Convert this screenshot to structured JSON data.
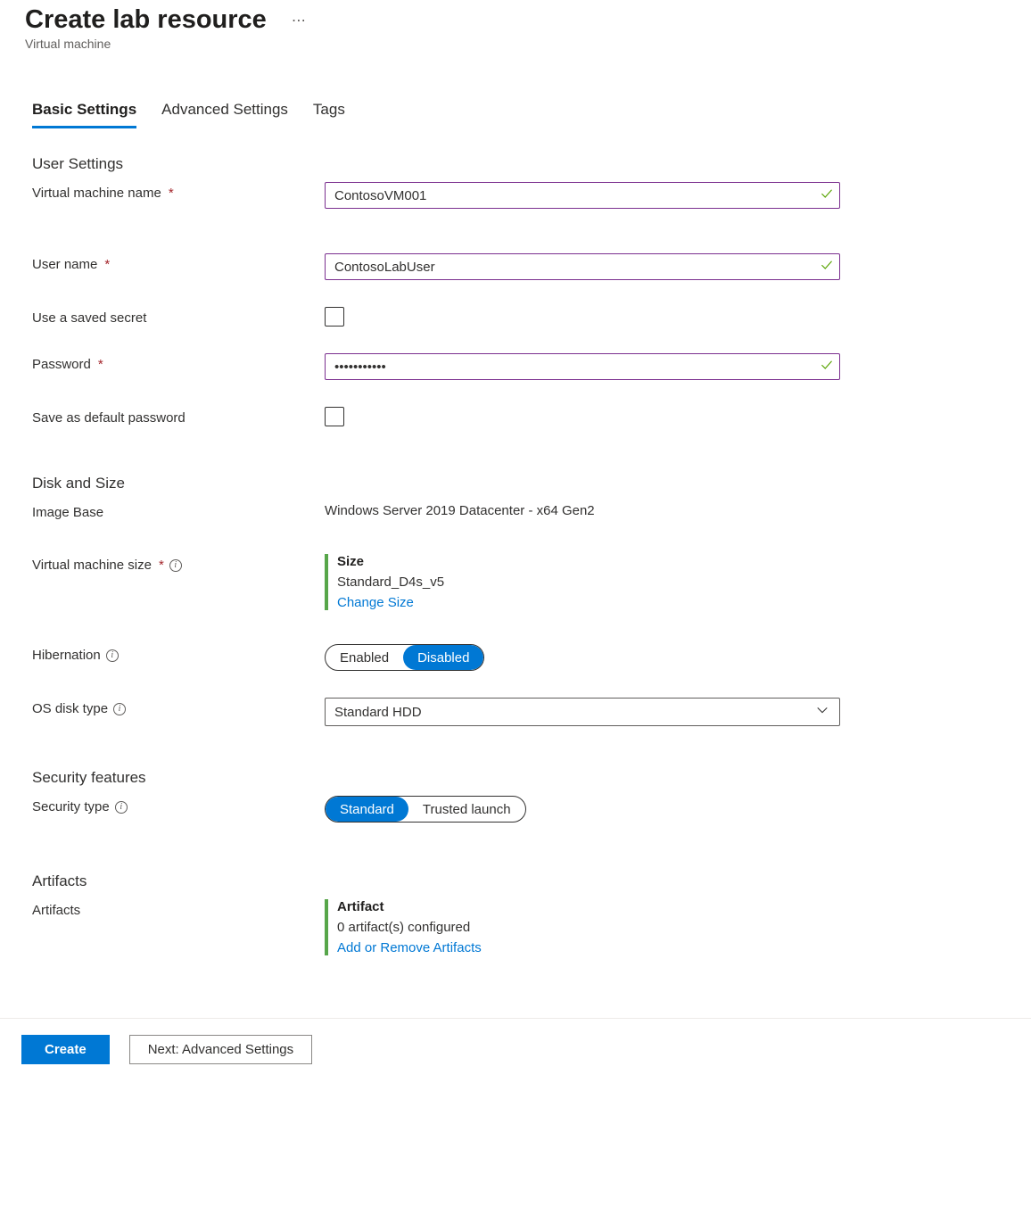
{
  "header": {
    "title": "Create lab resource",
    "subtitle": "Virtual machine",
    "more": "⋯"
  },
  "tabs": [
    {
      "label": "Basic Settings",
      "active": true
    },
    {
      "label": "Advanced Settings",
      "active": false
    },
    {
      "label": "Tags",
      "active": false
    }
  ],
  "sections": {
    "user_settings": {
      "heading": "User Settings",
      "vm_name_label": "Virtual machine name",
      "vm_name_value": "ContosoVM001",
      "user_name_label": "User name",
      "user_name_value": "ContosoLabUser",
      "use_saved_secret_label": "Use a saved secret",
      "password_label": "Password",
      "password_value": "•••••••••••",
      "save_default_pw_label": "Save as default password"
    },
    "disk_size": {
      "heading": "Disk and Size",
      "image_base_label": "Image Base",
      "image_base_value": "Windows Server 2019 Datacenter - x64 Gen2",
      "vm_size_label": "Virtual machine size",
      "size_title": "Size",
      "size_value": "Standard_D4s_v5",
      "change_size_link": "Change Size",
      "hibernation_label": "Hibernation",
      "hibernation_enabled": "Enabled",
      "hibernation_disabled": "Disabled",
      "os_disk_label": "OS disk type",
      "os_disk_value": "Standard HDD"
    },
    "security": {
      "heading": "Security features",
      "security_type_label": "Security type",
      "standard": "Standard",
      "trusted_launch": "Trusted launch"
    },
    "artifacts": {
      "heading": "Artifacts",
      "artifacts_label": "Artifacts",
      "block_title": "Artifact",
      "configured": "0 artifact(s) configured",
      "add_link": "Add or Remove Artifacts"
    }
  },
  "footer": {
    "create": "Create",
    "next": "Next: Advanced Settings"
  }
}
